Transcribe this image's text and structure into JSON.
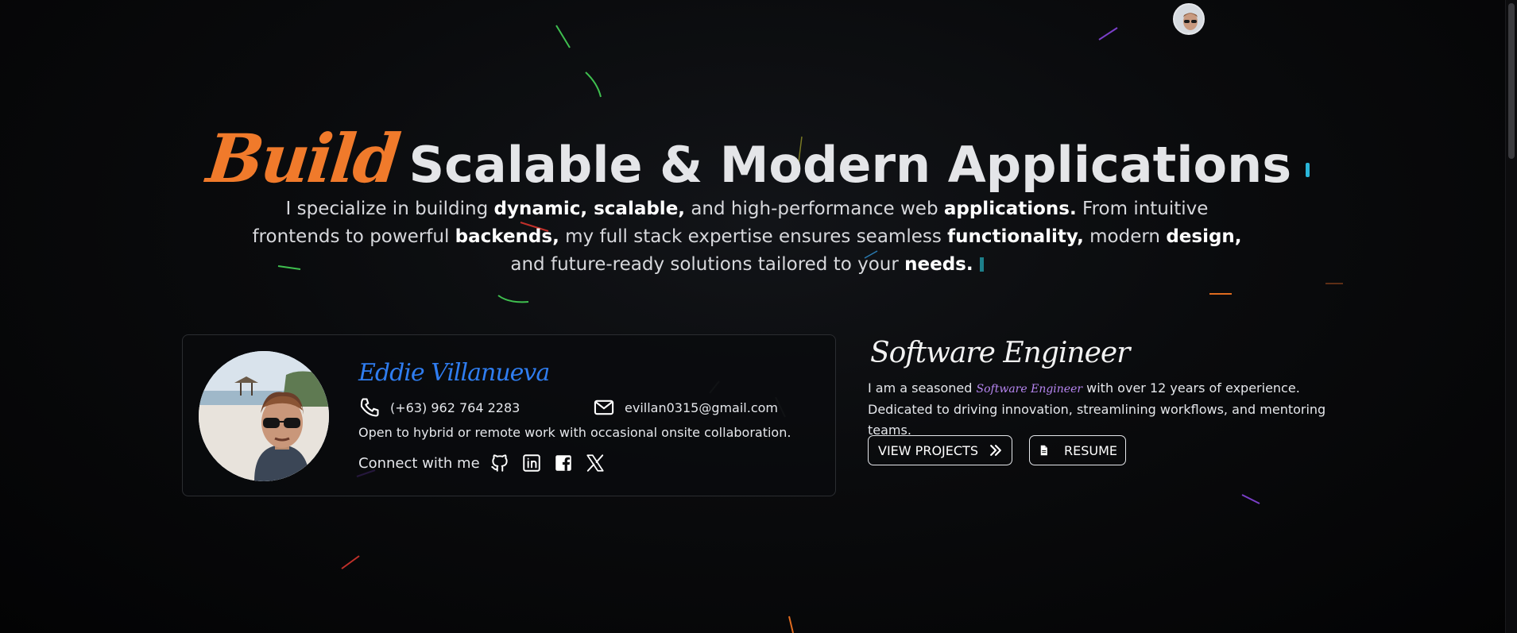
{
  "hero": {
    "title_accent": "Build",
    "title_rest": "Scalable & Modern Applications",
    "description": [
      {
        "text": "I specialize in building ",
        "bold": false
      },
      {
        "text": "dynamic, scalable,",
        "bold": true
      },
      {
        "text": " and high-performance web ",
        "bold": false
      },
      {
        "text": "applications.",
        "bold": true
      },
      {
        "text": " From intuitive frontends to powerful ",
        "bold": false
      },
      {
        "text": "backends,",
        "bold": true
      },
      {
        "text": " my full stack expertise ensures seamless ",
        "bold": false
      },
      {
        "text": "functionality,",
        "bold": true
      },
      {
        "text": " modern ",
        "bold": false
      },
      {
        "text": "design,",
        "bold": true
      },
      {
        "text": " and future-ready solutions tailored to your ",
        "bold": false
      },
      {
        "text": "needs.",
        "bold": true
      }
    ]
  },
  "profile_card": {
    "name": "Eddie Villanueva",
    "phone": "(+63) 962 764 2283",
    "email": "evillan0315@gmail.com",
    "work_preference": "Open to hybrid or remote work with occasional onsite collaboration.",
    "connect_label": "Connect with me",
    "social_icons": [
      "github-icon",
      "linkedin-icon",
      "facebook-icon",
      "x-icon"
    ]
  },
  "about": {
    "role": "Software Engineer",
    "desc_before": "I am a seasoned ",
    "desc_accent": "Software Engineer",
    "desc_after": " with over 12 years of experience. Dedicated to driving innovation, streamlining workflows, and mentoring teams."
  },
  "buttons": {
    "projects_label": "VIEW PROJECTS",
    "resume_label": "RESUME"
  },
  "colors": {
    "accent_orange": "#f07a2b",
    "name_blue": "#2f7df0",
    "role_purple": "#b685f0",
    "cursor_cyan": "#2ab6d9"
  }
}
